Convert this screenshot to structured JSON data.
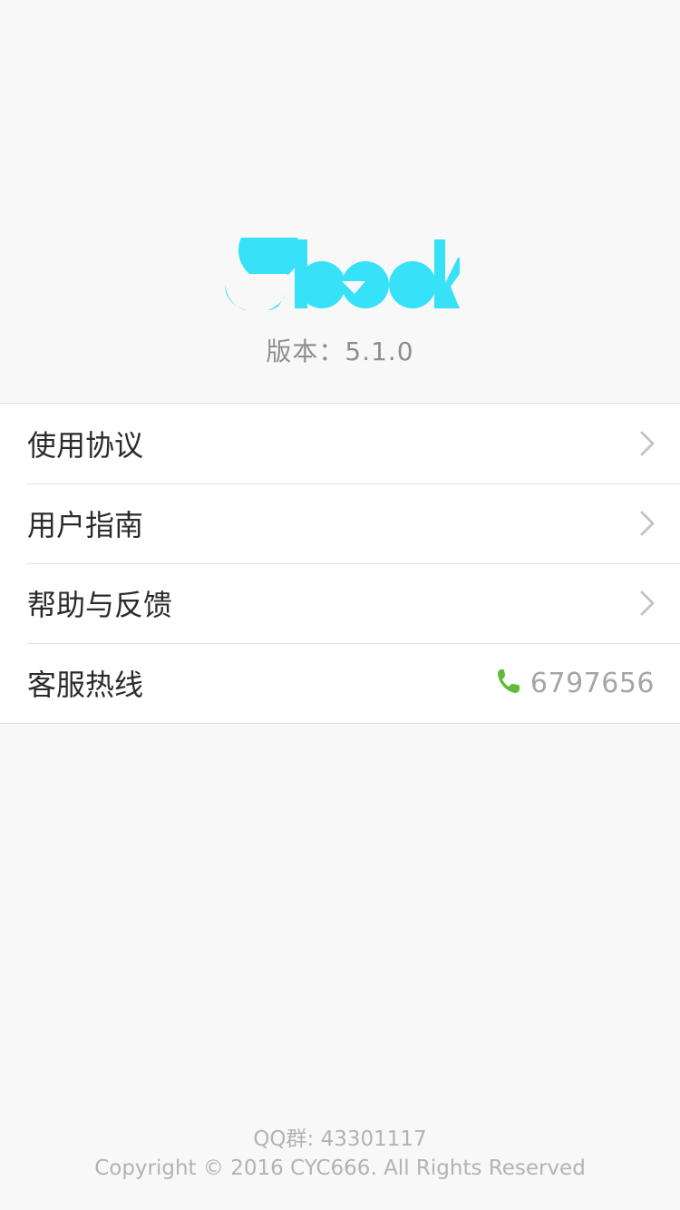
{
  "app": {
    "logo_text": "ebook",
    "brand_color": "#37e1f8"
  },
  "version": {
    "label": "版本：5.1.0"
  },
  "menu": {
    "items": [
      {
        "label": "使用协议",
        "icon": "chevron-right-icon"
      },
      {
        "label": "用户指南",
        "icon": "chevron-right-icon"
      },
      {
        "label": "帮助与反馈",
        "icon": "chevron-right-icon"
      }
    ],
    "hotline": {
      "label": "客服热线",
      "icon": "phone-icon",
      "icon_color": "#5cbb3a",
      "number": "6797656"
    }
  },
  "footer": {
    "qq_group": "QQ群: 43301117",
    "copyright": "Copyright © 2016 CYC666. All Rights Reserved"
  }
}
